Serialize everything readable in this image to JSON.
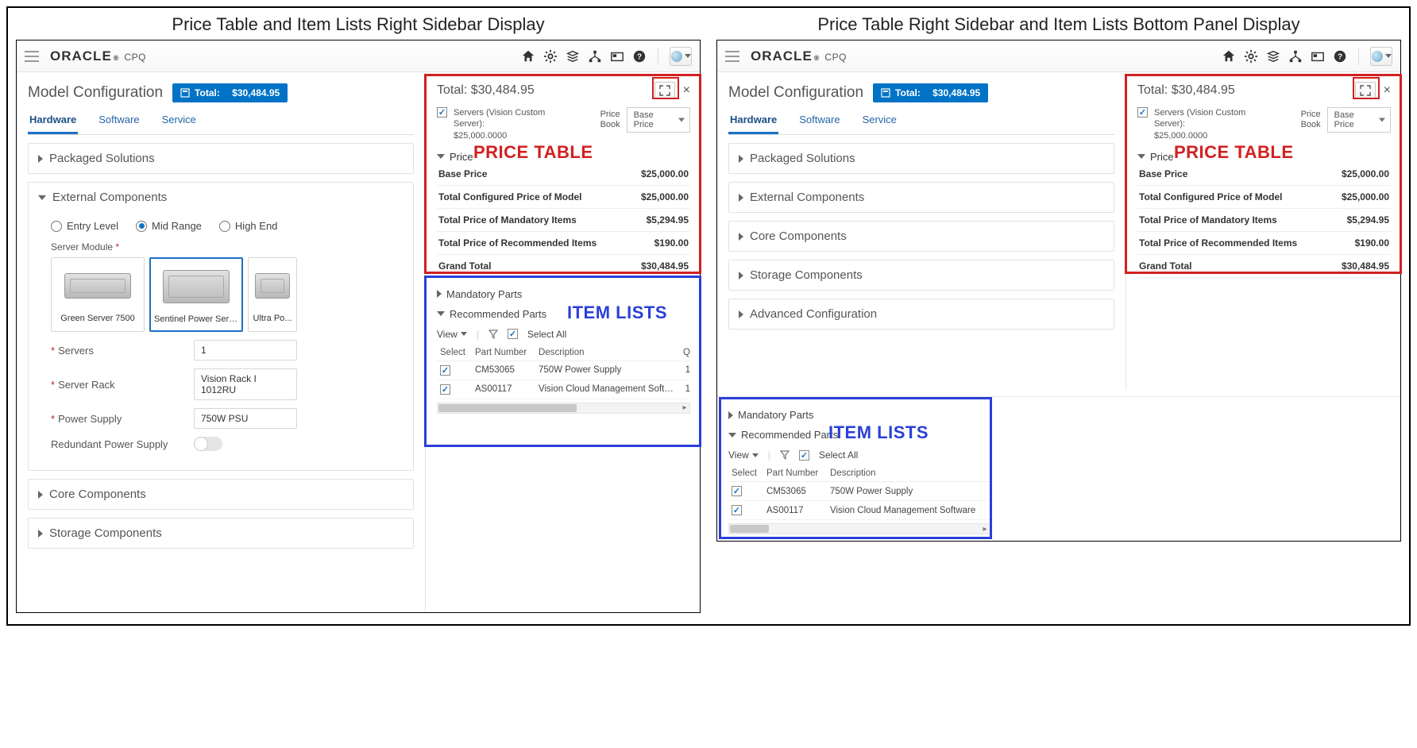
{
  "captions": {
    "left": "Price Table and Item Lists Right Sidebar Display",
    "right": "Price Table Right Sidebar and Item Lists Bottom Panel Display"
  },
  "brand": {
    "name": "ORACLE",
    "reg": "®",
    "product": "CPQ"
  },
  "header": {
    "title": "Model Configuration",
    "total_badge_prefix": "Total:",
    "total_badge_value": "$30,484.95"
  },
  "tabs": [
    "Hardware",
    "Software",
    "Service"
  ],
  "accordions": {
    "packaged": "Packaged Solutions",
    "external": "External Components",
    "core": "Core Components",
    "storage": "Storage Components",
    "advanced": "Advanced Configuration"
  },
  "external": {
    "levels": [
      "Entry Level",
      "Mid Range",
      "High End"
    ],
    "server_module_label": "Server Module",
    "cards": [
      "Green Server 7500",
      "Sentinel Power Server ...",
      "Ultra Po..."
    ],
    "fields": {
      "servers": {
        "label": "Servers",
        "value": "1"
      },
      "rack": {
        "label": "Server Rack",
        "value": "Vision Rack I 1012RU"
      },
      "psu": {
        "label": "Power Supply",
        "value": "750W PSU"
      },
      "redundant": {
        "label": "Redundant Power Supply"
      }
    }
  },
  "sidebar": {
    "total_label": "Total:",
    "total_value": "$30,484.95",
    "servers_label": "Servers (Vision Custom Server):",
    "servers_value": "$25,000.0000",
    "pricebook_label": "Price Book",
    "pricebook_value": "Base Price",
    "price_section": "Price",
    "price_rows": [
      {
        "name": "Base Price",
        "value": "$25,000.00"
      },
      {
        "name": "Total Configured Price of Model",
        "value": "$25,000.00"
      },
      {
        "name": "Total Price of Mandatory Items",
        "value": "$5,294.95"
      },
      {
        "name": "Total Price of Recommended Items",
        "value": "$190.00"
      },
      {
        "name": "Grand Total",
        "value": "$30,484.95"
      }
    ]
  },
  "item_lists": {
    "mandatory": "Mandatory Parts",
    "recommended": "Recommended Parts",
    "view": "View",
    "select_all": "Select All",
    "cols": {
      "select": "Select",
      "pn": "Part Number",
      "desc": "Description",
      "qty": "Q"
    },
    "rows": [
      {
        "pn": "CM53065",
        "desc": "750W Power Supply",
        "qty": "1"
      },
      {
        "pn": "AS00117",
        "desc": "Vision Cloud Management Software",
        "qty": "1"
      }
    ]
  },
  "anno": {
    "price_table": "PRICE TABLE",
    "item_lists": "ITEM LISTS"
  }
}
